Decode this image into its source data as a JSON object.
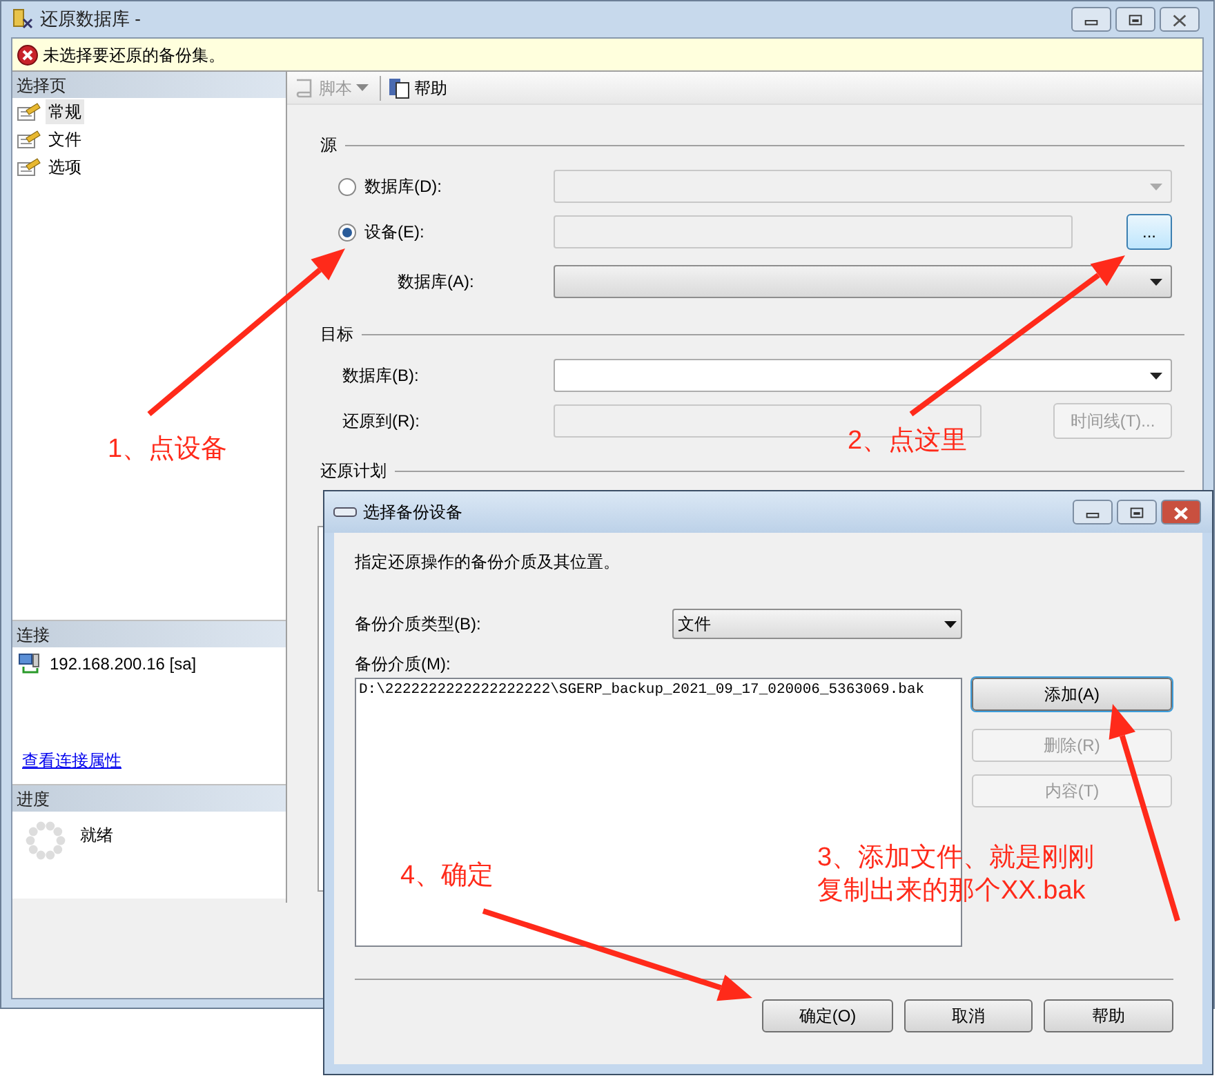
{
  "window": {
    "title": "还原数据库 -"
  },
  "error_banner": {
    "text": "未选择要还原的备份集。"
  },
  "sidebar": {
    "select_page": {
      "header": "选择页",
      "items": [
        {
          "label": "常规",
          "selected": true
        },
        {
          "label": "文件",
          "selected": false
        },
        {
          "label": "选项",
          "selected": false
        }
      ]
    },
    "connection": {
      "header": "连接",
      "server": "192.168.200.16 [sa]",
      "link": "查看连接属性"
    },
    "progress": {
      "header": "进度",
      "status": "就绪"
    }
  },
  "toolbar": {
    "items": [
      {
        "label": "脚本",
        "kind": "script",
        "disabled": true
      },
      {
        "label": "帮助",
        "kind": "help",
        "disabled": false
      }
    ]
  },
  "source": {
    "title": "源",
    "options": [
      {
        "label": "数据库(D):",
        "selected": false
      },
      {
        "label": "设备(E):",
        "selected": true
      }
    ],
    "browse_button": "...",
    "database_label": "数据库(A):"
  },
  "target": {
    "title": "目标",
    "database_label": "数据库(B):",
    "restore_to_label": "还原到(R):",
    "timeline_button": "时间线(T)..."
  },
  "plan": {
    "title": "还原计划"
  },
  "dialog": {
    "title": "选择备份设备",
    "description": "指定还原操作的备份介质及其位置。",
    "media_type_label": "备份介质类型(B):",
    "media_type_value": "文件",
    "media_label": "备份介质(M):",
    "media": [
      "D:\\2222222222222222222\\SGERP_backup_2021_09_17_020006_5363069.bak"
    ],
    "side_buttons": [
      {
        "label": "添加(A)",
        "disabled": false,
        "focused": true
      },
      {
        "label": "删除(R)",
        "disabled": true,
        "focused": false
      },
      {
        "label": "内容(T)",
        "disabled": true,
        "focused": false
      }
    ],
    "buttons": [
      "确定(O)",
      "取消",
      "帮助"
    ]
  },
  "annotations": [
    {
      "lines": [
        "1、点设备"
      ]
    },
    {
      "lines": [
        "2、点这里"
      ]
    },
    {
      "lines": [
        "4、确定"
      ]
    },
    {
      "lines": [
        "3、添加文件、就是刚刚",
        "复制出来的那个XX.bak"
      ]
    }
  ]
}
